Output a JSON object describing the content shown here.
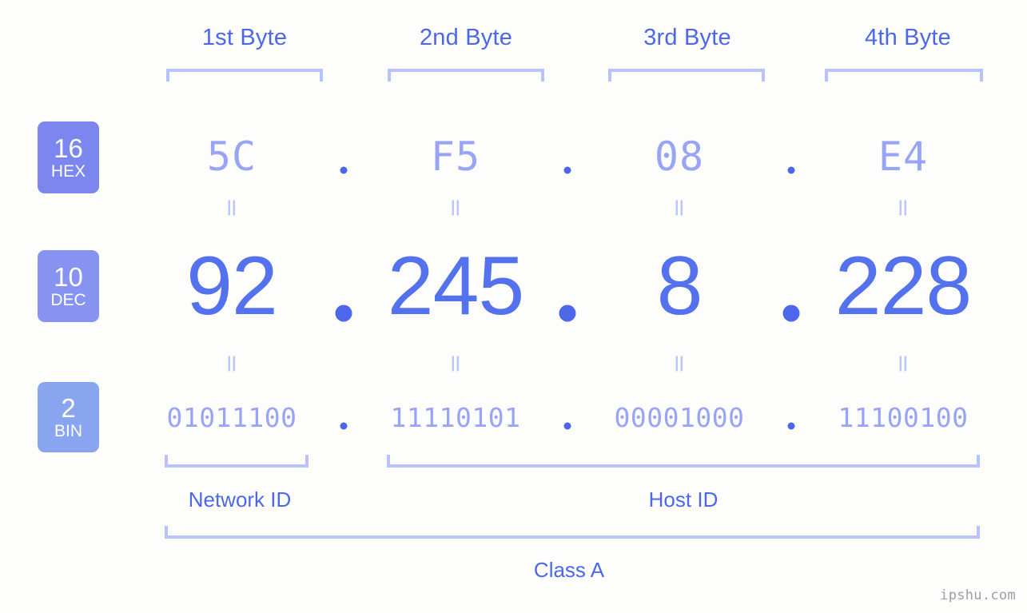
{
  "watermark": "ipshu.com",
  "byte_headers": [
    {
      "label": "1st Byte"
    },
    {
      "label": "2nd Byte"
    },
    {
      "label": "3rd Byte"
    },
    {
      "label": "4th Byte"
    }
  ],
  "bases": {
    "hex": {
      "radix": "16",
      "abbr": "HEX"
    },
    "dec": {
      "radix": "10",
      "abbr": "DEC"
    },
    "bin": {
      "radix": "2",
      "abbr": "BIN"
    }
  },
  "separator": ".",
  "equals_mark": "=",
  "rows": {
    "hex": [
      "5C",
      "F5",
      "08",
      "E4"
    ],
    "dec": [
      "92",
      "245",
      "8",
      "228"
    ],
    "bin": [
      "01011100",
      "11110101",
      "00001000",
      "11100100"
    ]
  },
  "segments": {
    "network_id": "Network ID",
    "host_id": "Host ID",
    "class": "Class A"
  },
  "colors": {
    "background": "#fdfefb",
    "accent_strong": "#4d67ea",
    "accent_value": "#5471ee",
    "accent_light": "#98a4f5",
    "bracket": "#b8c2fb",
    "badge_hex": "#7b86ee",
    "badge_dec": "#8793f0",
    "badge_bin": "#8aa5f0",
    "watermark": "#9aa0a6"
  }
}
